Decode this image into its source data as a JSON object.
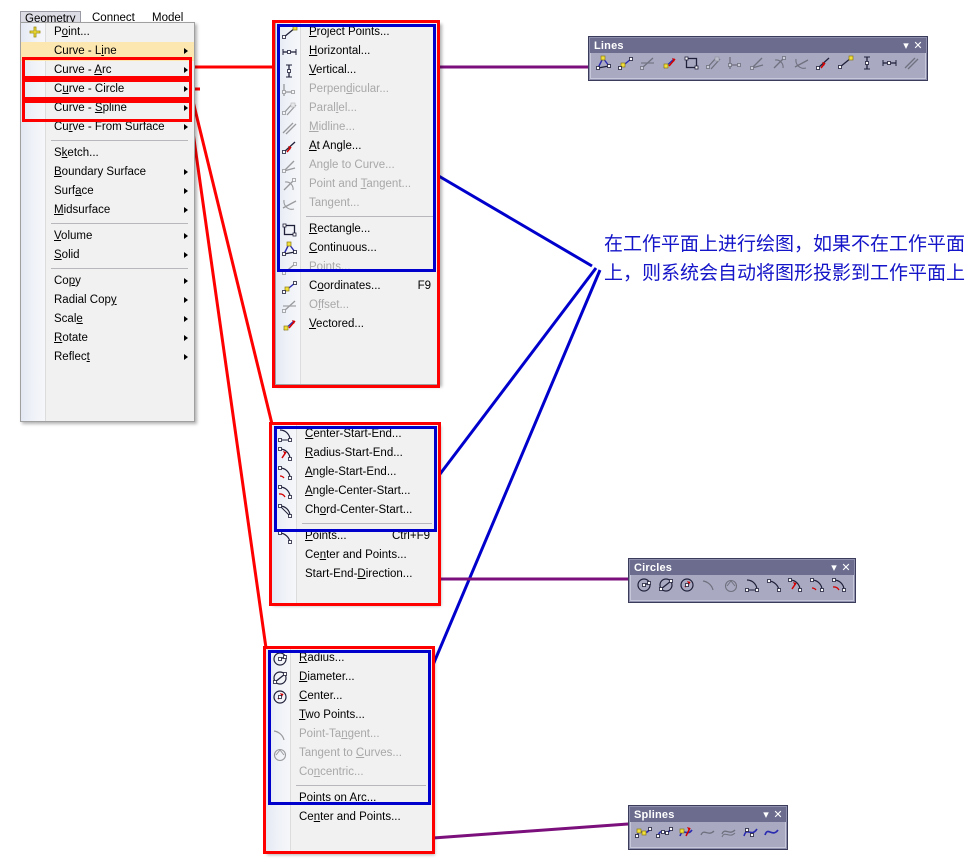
{
  "menubar": {
    "items": [
      {
        "label": "Geometry",
        "active": true
      },
      {
        "label": "Connect",
        "active": false
      },
      {
        "label": "Model",
        "active": false
      }
    ]
  },
  "main_menu": {
    "items": [
      {
        "label": "Point...",
        "icon": "point-plus-icon",
        "arrow": false,
        "disabled": false,
        "selected": false,
        "sep_after": false
      },
      {
        "label": "Curve - Line",
        "icon": "",
        "arrow": true,
        "disabled": false,
        "selected": true,
        "sep_after": false
      },
      {
        "label": "Curve - Arc",
        "icon": "",
        "arrow": true,
        "disabled": false,
        "selected": false,
        "sep_after": false
      },
      {
        "label": "Curve - Circle",
        "icon": "",
        "arrow": true,
        "disabled": false,
        "selected": false,
        "sep_after": false
      },
      {
        "label": "Curve - Spline",
        "icon": "",
        "arrow": true,
        "disabled": false,
        "selected": false,
        "sep_after": false
      },
      {
        "label": "Curve - From Surface",
        "icon": "",
        "arrow": true,
        "disabled": false,
        "selected": false,
        "sep_after": true
      },
      {
        "label": "Sketch...",
        "icon": "",
        "arrow": false,
        "disabled": false,
        "selected": false,
        "sep_after": false
      },
      {
        "label": "Boundary Surface",
        "icon": "",
        "arrow": true,
        "disabled": false,
        "selected": false,
        "sep_after": false
      },
      {
        "label": "Surface",
        "icon": "",
        "arrow": true,
        "disabled": false,
        "selected": false,
        "sep_after": false
      },
      {
        "label": "Midsurface",
        "icon": "",
        "arrow": true,
        "disabled": false,
        "selected": false,
        "sep_after": true
      },
      {
        "label": "Volume",
        "icon": "",
        "arrow": true,
        "disabled": false,
        "selected": false,
        "sep_after": false
      },
      {
        "label": "Solid",
        "icon": "",
        "arrow": true,
        "disabled": false,
        "selected": false,
        "sep_after": true
      },
      {
        "label": "Copy",
        "icon": "",
        "arrow": true,
        "disabled": false,
        "selected": false,
        "sep_after": false
      },
      {
        "label": "Radial Copy",
        "icon": "",
        "arrow": true,
        "disabled": false,
        "selected": false,
        "sep_after": false
      },
      {
        "label": "Scale",
        "icon": "",
        "arrow": true,
        "disabled": false,
        "selected": false,
        "sep_after": false
      },
      {
        "label": "Rotate",
        "icon": "",
        "arrow": true,
        "disabled": false,
        "selected": false,
        "sep_after": false
      },
      {
        "label": "Reflect",
        "icon": "",
        "arrow": true,
        "disabled": false,
        "selected": false,
        "sep_after": false
      }
    ]
  },
  "line_menu": {
    "items": [
      {
        "label": "Project Points...",
        "accel": "",
        "disabled": false,
        "icon": "line-project-points-icon",
        "sep_after": false
      },
      {
        "label": "Horizontal...",
        "accel": "",
        "disabled": false,
        "icon": "line-horizontal-icon",
        "sep_after": false
      },
      {
        "label": "Vertical...",
        "accel": "",
        "disabled": false,
        "icon": "line-vertical-icon",
        "sep_after": false
      },
      {
        "label": "Perpendicular...",
        "accel": "",
        "disabled": true,
        "icon": "line-perpendicular-icon",
        "sep_after": false
      },
      {
        "label": "Parallel...",
        "accel": "",
        "disabled": true,
        "icon": "line-parallel-icon",
        "sep_after": false
      },
      {
        "label": "Midline...",
        "accel": "",
        "disabled": true,
        "icon": "line-midline-icon",
        "sep_after": false
      },
      {
        "label": "At Angle...",
        "accel": "",
        "disabled": false,
        "icon": "line-at-angle-icon",
        "sep_after": false
      },
      {
        "label": "Angle to Curve...",
        "accel": "",
        "disabled": true,
        "icon": "line-angle-to-curve-icon",
        "sep_after": false
      },
      {
        "label": "Point and Tangent...",
        "accel": "",
        "disabled": true,
        "icon": "line-point-tangent-icon",
        "sep_after": false
      },
      {
        "label": "Tangent...",
        "accel": "",
        "disabled": true,
        "icon": "line-tangent-icon",
        "sep_after": true
      },
      {
        "label": "Rectangle...",
        "accel": "",
        "disabled": false,
        "icon": "line-rectangle-icon",
        "sep_after": false
      },
      {
        "label": "Continuous...",
        "accel": "",
        "disabled": false,
        "icon": "line-continuous-icon",
        "sep_after": false
      },
      {
        "label": "Points...",
        "accel": "",
        "disabled": true,
        "icon": "line-points-icon",
        "sep_after": false
      },
      {
        "label": "Coordinates...",
        "accel": "F9",
        "disabled": false,
        "icon": "line-coordinates-icon",
        "sep_after": false
      },
      {
        "label": "Offset...",
        "accel": "",
        "disabled": true,
        "icon": "line-offset-icon",
        "sep_after": false
      },
      {
        "label": "Vectored...",
        "accel": "",
        "disabled": false,
        "icon": "line-vectored-icon",
        "sep_after": false
      }
    ]
  },
  "arc_menu": {
    "items": [
      {
        "label": "Center-Start-End...",
        "accel": "",
        "disabled": false,
        "icon": "arc-center-start-end-icon",
        "sep_after": false
      },
      {
        "label": "Radius-Start-End...",
        "accel": "",
        "disabled": false,
        "icon": "arc-radius-start-end-icon",
        "sep_after": false
      },
      {
        "label": "Angle-Start-End...",
        "accel": "",
        "disabled": false,
        "icon": "arc-angle-start-end-icon",
        "sep_after": false
      },
      {
        "label": "Angle-Center-Start...",
        "accel": "",
        "disabled": false,
        "icon": "arc-angle-center-start-icon",
        "sep_after": false
      },
      {
        "label": "Chord-Center-Start...",
        "accel": "",
        "disabled": false,
        "icon": "arc-chord-center-start-icon",
        "sep_after": true
      },
      {
        "label": "Points...",
        "accel": "Ctrl+F9",
        "disabled": false,
        "icon": "arc-points-icon",
        "sep_after": false
      },
      {
        "label": "Center and Points...",
        "accel": "",
        "disabled": false,
        "icon": "",
        "sep_after": false
      },
      {
        "label": "Start-End-Direction...",
        "accel": "",
        "disabled": false,
        "icon": "",
        "sep_after": false
      }
    ]
  },
  "circle_menu": {
    "items": [
      {
        "label": "Radius...",
        "accel": "",
        "disabled": false,
        "icon": "circle-radius-icon",
        "sep_after": false
      },
      {
        "label": "Diameter...",
        "accel": "",
        "disabled": false,
        "icon": "circle-diameter-icon",
        "sep_after": false
      },
      {
        "label": "Center...",
        "accel": "",
        "disabled": false,
        "icon": "circle-center-icon",
        "sep_after": false
      },
      {
        "label": "Two Points...",
        "accel": "",
        "disabled": false,
        "icon": "",
        "sep_after": false
      },
      {
        "label": "Point-Tangent...",
        "accel": "",
        "disabled": true,
        "icon": "circle-point-tangent-icon",
        "sep_after": false
      },
      {
        "label": "Tangent to Curves...",
        "accel": "",
        "disabled": true,
        "icon": "circle-tangent-curves-icon",
        "sep_after": false
      },
      {
        "label": "Concentric...",
        "accel": "",
        "disabled": true,
        "icon": "",
        "sep_after": true
      },
      {
        "label": "Points on Arc...",
        "accel": "",
        "disabled": false,
        "icon": "",
        "sep_after": false
      },
      {
        "label": "Center and Points...",
        "accel": "",
        "disabled": false,
        "icon": "",
        "sep_after": false
      }
    ]
  },
  "toolbars": [
    {
      "id": "lines",
      "title": "Lines",
      "dropdown": "▾",
      "close": "✕",
      "buttons": [
        {
          "icon": "line-continuous-icon",
          "disabled": false
        },
        {
          "icon": "line-coordinates-icon",
          "disabled": false
        },
        {
          "icon": "line-offset-icon",
          "disabled": true
        },
        {
          "icon": "line-vectored-icon",
          "disabled": false
        },
        {
          "icon": "line-rectangle-icon",
          "disabled": false
        },
        {
          "icon": "line-parallel-icon",
          "disabled": true
        },
        {
          "icon": "line-perpendicular-icon",
          "disabled": true
        },
        {
          "icon": "line-angle-to-curve-icon",
          "disabled": true
        },
        {
          "icon": "line-point-tangent-icon",
          "disabled": true
        },
        {
          "icon": "line-tangent-icon",
          "disabled": true
        },
        {
          "icon": "line-at-angle-icon",
          "disabled": false
        },
        {
          "icon": "line-project-points-icon",
          "disabled": false
        },
        {
          "icon": "line-vertical-icon",
          "disabled": false
        },
        {
          "icon": "line-horizontal-icon",
          "disabled": false
        },
        {
          "icon": "line-midline-icon",
          "disabled": true
        }
      ]
    },
    {
      "id": "circles",
      "title": "Circles",
      "dropdown": "▾",
      "close": "✕",
      "buttons": [
        {
          "icon": "circle-radius-icon",
          "disabled": false
        },
        {
          "icon": "circle-diameter-icon",
          "disabled": false
        },
        {
          "icon": "circle-center-icon",
          "disabled": false
        },
        {
          "icon": "circle-point-tangent-icon",
          "disabled": true
        },
        {
          "icon": "circle-tangent-curves-icon",
          "disabled": true
        },
        {
          "icon": "arc-center-start-end-icon",
          "disabled": false
        },
        {
          "icon": "arc-points-icon",
          "disabled": false
        },
        {
          "icon": "arc-radius-start-end-icon",
          "disabled": false
        },
        {
          "icon": "arc-angle-start-end-icon",
          "disabled": false
        },
        {
          "icon": "arc-angle-center-start-icon",
          "disabled": false
        }
      ]
    },
    {
      "id": "splines",
      "title": "Splines",
      "dropdown": "▾",
      "close": "✕",
      "buttons": [
        {
          "icon": "spline-control-points-icon",
          "disabled": false
        },
        {
          "icon": "spline-through-points-icon",
          "disabled": false
        },
        {
          "icon": "spline-vectored-icon",
          "disabled": false
        },
        {
          "icon": "spline-blend-icon",
          "disabled": true
        },
        {
          "icon": "spline-offset-icon",
          "disabled": true
        },
        {
          "icon": "spline-fit-icon",
          "disabled": false
        },
        {
          "icon": "spline-edit-icon",
          "disabled": false
        }
      ]
    }
  ],
  "annotation": {
    "text": "在工作平面上进行绘图，如果不在工作平面上，则系统会自动将图形投影到工作平面上",
    "color": "#1414c8"
  },
  "colors": {
    "highlight_red": "#ff0000",
    "highlight_blue": "#0000cd",
    "connector_purple": "#7b0f7b",
    "menu_selected": "#fde7b0",
    "toolbar_titlebar": "#6b6c8e",
    "toolbar_body": "#a9aac2"
  }
}
